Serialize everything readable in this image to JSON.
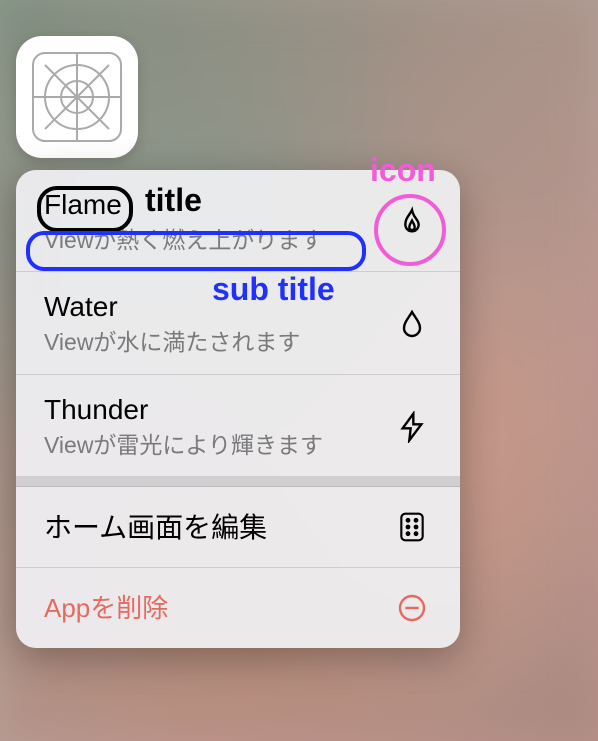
{
  "annotations": {
    "title_label": "title",
    "subtitle_label": "sub title",
    "icon_label": "icon"
  },
  "menu": {
    "items": [
      {
        "title": "Flame",
        "subtitle": "Viewが熱く燃え上がります",
        "icon": "flame"
      },
      {
        "title": "Water",
        "subtitle": "Viewが水に満たされます",
        "icon": "drop"
      },
      {
        "title": "Thunder",
        "subtitle": "Viewが雷光により輝きます",
        "icon": "bolt"
      }
    ],
    "system": [
      {
        "title": "ホーム画面を編集",
        "icon": "apps"
      },
      {
        "title": "Appを削除",
        "icon": "remove",
        "danger": true
      }
    ]
  }
}
